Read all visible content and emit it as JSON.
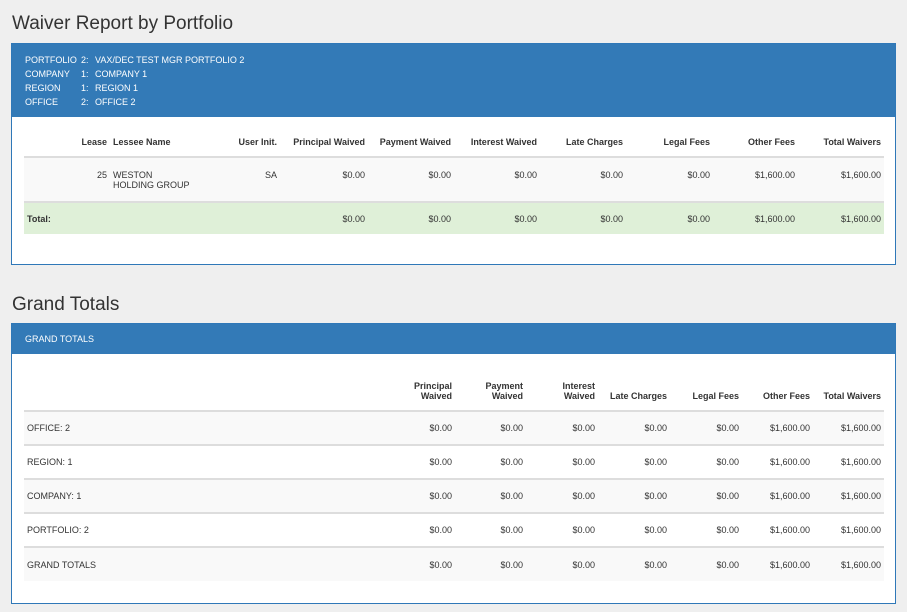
{
  "report": {
    "title": "Waiver Report by Portfolio",
    "header": [
      {
        "key": "PORTFOLIO",
        "num": "2:",
        "value": "VAX/DEC TEST MGR PORTFOLIO 2"
      },
      {
        "key": "COMPANY",
        "num": "1:",
        "value": "COMPANY 1"
      },
      {
        "key": "REGION",
        "num": "1:",
        "value": "REGION 1"
      },
      {
        "key": "OFFICE",
        "num": "2:",
        "value": "OFFICE 2"
      }
    ],
    "columns": {
      "lease": "Lease",
      "lessee": "Lessee Name",
      "user": "User Init.",
      "principal": "Principal Waived",
      "payment": "Payment Waived",
      "interest": "Interest Waived",
      "late": "Late Charges",
      "legal": "Legal Fees",
      "other": "Other Fees",
      "total": "Total Waivers"
    },
    "rows": [
      {
        "lease": "25",
        "lessee_line1": "WESTON",
        "lessee_line2": "HOLDING GROUP",
        "user": "SA",
        "principal": "$0.00",
        "payment": "$0.00",
        "interest": "$0.00",
        "late": "$0.00",
        "legal": "$0.00",
        "other": "$1,600.00",
        "total": "$1,600.00"
      }
    ],
    "total": {
      "label": "Total:",
      "principal": "$0.00",
      "payment": "$0.00",
      "interest": "$0.00",
      "late": "$0.00",
      "legal": "$0.00",
      "other": "$1,600.00",
      "total": "$1,600.00"
    }
  },
  "grand": {
    "title": "Grand Totals",
    "panel_label": "GRAND TOTALS",
    "columns": {
      "principal_1": "Principal",
      "principal_2": "Waived",
      "payment_1": "Payment",
      "payment_2": "Waived",
      "interest_1": "Interest",
      "interest_2": "Waived",
      "late": "Late Charges",
      "legal": "Legal Fees",
      "other": "Other Fees",
      "total": "Total Waivers"
    },
    "rows": [
      {
        "label": "OFFICE: 2",
        "principal": "$0.00",
        "payment": "$0.00",
        "interest": "$0.00",
        "late": "$0.00",
        "legal": "$0.00",
        "other": "$1,600.00",
        "total": "$1,600.00"
      },
      {
        "label": "REGION: 1",
        "principal": "$0.00",
        "payment": "$0.00",
        "interest": "$0.00",
        "late": "$0.00",
        "legal": "$0.00",
        "other": "$1,600.00",
        "total": "$1,600.00"
      },
      {
        "label": "COMPANY: 1",
        "principal": "$0.00",
        "payment": "$0.00",
        "interest": "$0.00",
        "late": "$0.00",
        "legal": "$0.00",
        "other": "$1,600.00",
        "total": "$1,600.00"
      },
      {
        "label": "PORTFOLIO: 2",
        "principal": "$0.00",
        "payment": "$0.00",
        "interest": "$0.00",
        "late": "$0.00",
        "legal": "$0.00",
        "other": "$1,600.00",
        "total": "$1,600.00"
      },
      {
        "label": "GRAND TOTALS",
        "principal": "$0.00",
        "payment": "$0.00",
        "interest": "$0.00",
        "late": "$0.00",
        "legal": "$0.00",
        "other": "$1,600.00",
        "total": "$1,600.00"
      }
    ]
  }
}
